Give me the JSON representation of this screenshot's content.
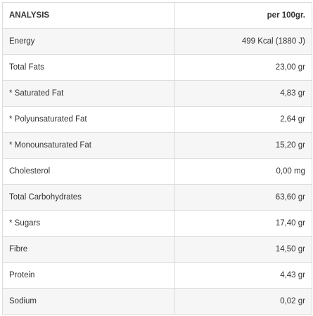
{
  "table": {
    "header": {
      "analysis_label": "ANALYSIS",
      "per_label": "per 100gr."
    },
    "rows": [
      {
        "name": "Energy",
        "value": "499 Kcal (1880 J)"
      },
      {
        "name": "Total Fats",
        "value": "23,00 gr"
      },
      {
        "name": "* Saturated Fat",
        "value": "4,83 gr"
      },
      {
        "name": "* Polyunsaturated Fat",
        "value": "2,64 gr"
      },
      {
        "name": "* Monounsaturated Fat",
        "value": "15,20 gr"
      },
      {
        "name": "Cholesterol",
        "value": "0,00 mg"
      },
      {
        "name": "Total Carbohydrates",
        "value": "63,60 gr"
      },
      {
        "name": "* Sugars",
        "value": "17,40 gr"
      },
      {
        "name": "Fibre",
        "value": "14,50 gr"
      },
      {
        "name": "Protein",
        "value": "4,43 gr"
      },
      {
        "name": "Sodium",
        "value": "0,02 gr"
      }
    ]
  }
}
